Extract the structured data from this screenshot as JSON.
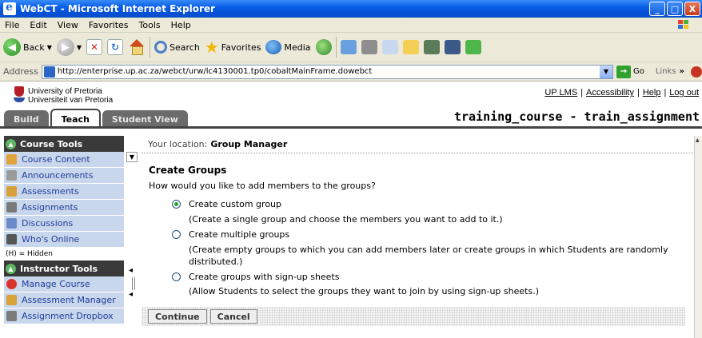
{
  "window": {
    "title": "WebCT - Microsoft Internet Explorer",
    "controls": {
      "minimize": "_",
      "maximize": "□",
      "close": "X"
    }
  },
  "menu": [
    "File",
    "Edit",
    "View",
    "Favorites",
    "Tools",
    "Help"
  ],
  "toolbar": {
    "back_label": "Back",
    "search_label": "Search",
    "favorites_label": "Favorites",
    "media_label": "Media"
  },
  "address": {
    "label": "Address",
    "url": "http://enterprise.up.ac.za/webct/urw/lc4130001.tp0/cobaltMainFrame.dowebct",
    "go_label": "Go",
    "links_label": "Links",
    "links_chevron": "»"
  },
  "header": {
    "university_line1": "University of Pretoria",
    "university_line2": "Universiteit van Pretoria",
    "links": [
      "UP LMS",
      "Accessibility",
      "Help",
      "Log out"
    ],
    "tabs": [
      {
        "label": "Build",
        "active": false
      },
      {
        "label": "Teach",
        "active": true
      },
      {
        "label": "Student View",
        "active": false
      }
    ],
    "course_title": "training_course - train_assignment"
  },
  "sidebar": {
    "course_tools_title": "Course Tools",
    "course_items": [
      {
        "label": "Course Content",
        "icon": "home-icon"
      },
      {
        "label": "Announcements",
        "icon": "megaphone-icon"
      },
      {
        "label": "Assessments",
        "icon": "quiz-icon"
      },
      {
        "label": "Assignments",
        "icon": "assignment-icon"
      },
      {
        "label": "Discussions",
        "icon": "discussion-icon"
      },
      {
        "label": "Who's Online",
        "icon": "online-icon"
      }
    ],
    "hidden_note": "(H) = Hidden",
    "instructor_tools_title": "Instructor Tools",
    "instructor_items": [
      {
        "label": "Manage Course",
        "icon": "manage-icon"
      },
      {
        "label": "Assessment Manager",
        "icon": "quiz-icon"
      },
      {
        "label": "Assignment Dropbox",
        "icon": "dropbox-icon"
      }
    ]
  },
  "main": {
    "location_label": "Your location:",
    "location_value": "Group Manager",
    "page_title": "Create Groups",
    "question": "How would you like to add members to the groups?",
    "options": [
      {
        "label": "Create custom group",
        "desc": "(Create a single group and choose the members you want to add to it.)",
        "selected": true
      },
      {
        "label": "Create multiple groups",
        "desc": "(Create empty groups to which you can add members later or create groups in which Students are randomly distributed.)",
        "selected": false
      },
      {
        "label": "Create groups with sign-up sheets",
        "desc": "(Allow Students to select the groups they want to join by using sign-up sheets.)",
        "selected": false
      }
    ],
    "continue_label": "Continue",
    "cancel_label": "Cancel"
  }
}
